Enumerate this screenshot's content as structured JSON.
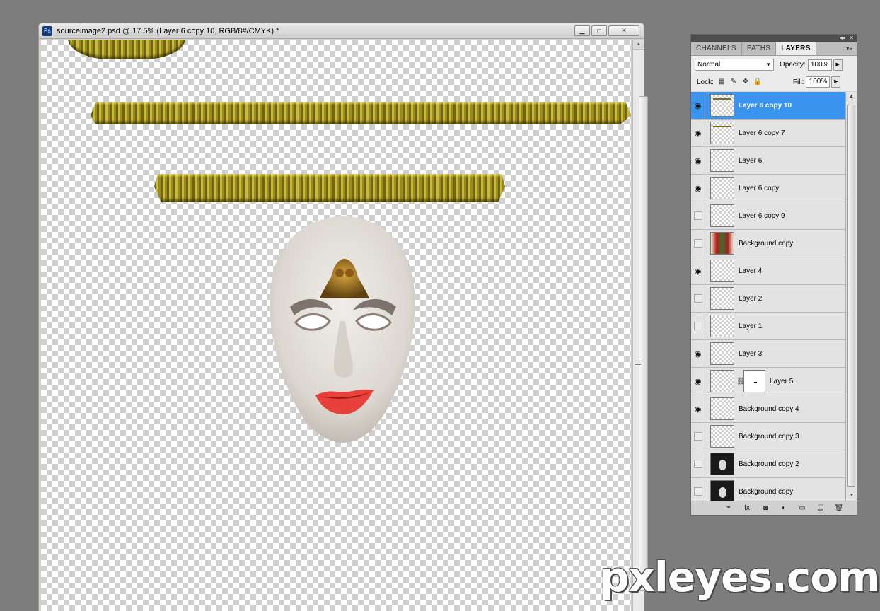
{
  "document": {
    "title": "sourceimage2.psd @ 17.5% (Layer 6 copy 10, RGB/8#/CMYK) *",
    "app_icon": "Ps"
  },
  "panel": {
    "tabs": [
      {
        "label": "CHANNELS",
        "active": false
      },
      {
        "label": "PATHS",
        "active": false
      },
      {
        "label": "LAYERS",
        "active": true
      }
    ],
    "blend_mode": "Normal",
    "opacity_label": "Opacity:",
    "opacity_value": "100%",
    "lock_label": "Lock:",
    "fill_label": "Fill:",
    "fill_value": "100%"
  },
  "layers": [
    {
      "name": "Layer 6 copy 10",
      "visible": true,
      "selected": true,
      "thumb": "bar"
    },
    {
      "name": "Layer 6 copy 7",
      "visible": true,
      "selected": false,
      "thumb": "bar"
    },
    {
      "name": "Layer 6",
      "visible": true,
      "selected": false,
      "thumb": "blank"
    },
    {
      "name": "Layer 6 copy",
      "visible": true,
      "selected": false,
      "thumb": "blank"
    },
    {
      "name": "Layer 6 copy 9",
      "visible": false,
      "selected": false,
      "thumb": "blank"
    },
    {
      "name": "Background copy",
      "visible": false,
      "selected": false,
      "thumb": "photo"
    },
    {
      "name": "Layer 4",
      "visible": true,
      "selected": false,
      "thumb": "blank"
    },
    {
      "name": "Layer 2",
      "visible": false,
      "selected": false,
      "thumb": "blank"
    },
    {
      "name": "Layer 1",
      "visible": false,
      "selected": false,
      "thumb": "blank"
    },
    {
      "name": "Layer 3",
      "visible": true,
      "selected": false,
      "thumb": "blank"
    },
    {
      "name": "Layer 5",
      "visible": true,
      "selected": false,
      "thumb": "blank",
      "has_mask": true
    },
    {
      "name": "Background copy 4",
      "visible": true,
      "selected": false,
      "thumb": "blank"
    },
    {
      "name": "Background copy 3",
      "visible": false,
      "selected": false,
      "thumb": "blank"
    },
    {
      "name": "Background copy 2",
      "visible": false,
      "selected": false,
      "thumb": "dark"
    },
    {
      "name": "Background copy",
      "visible": false,
      "selected": false,
      "thumb": "dark"
    }
  ],
  "footer_icons": [
    "link-icon",
    "fx-icon",
    "add-mask-icon",
    "adjustment-icon",
    "folder-icon",
    "new-layer-icon",
    "trash-icon"
  ],
  "watermark": "pxleyes.com",
  "colors": {
    "selection": "#3b94ee",
    "workspace": "#7d7d7d"
  }
}
